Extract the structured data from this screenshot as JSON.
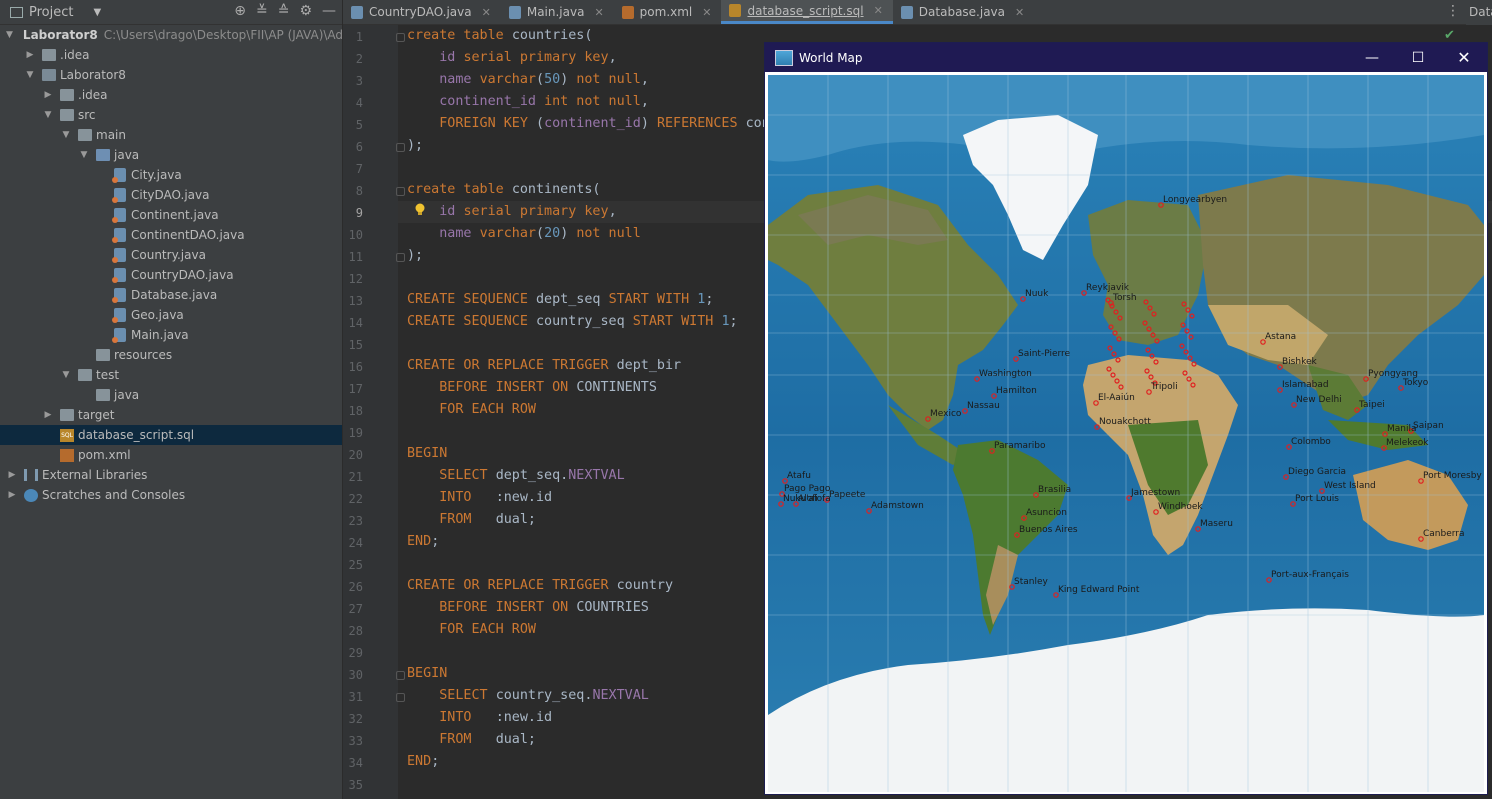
{
  "project_panel": {
    "title": "Project",
    "tree": [
      {
        "label": "Laborator8",
        "path": "C:\\Users\\drago\\Desktop\\FII\\AP (JAVA)\\AdvP",
        "icon": "module-folder-icon",
        "indent": 0,
        "arrow": "down",
        "bold": true
      },
      {
        "label": ".idea",
        "icon": "folder-icon",
        "indent": 1,
        "arrow": "right"
      },
      {
        "label": "Laborator8",
        "icon": "module-folder-icon",
        "indent": 1,
        "arrow": "down"
      },
      {
        "label": ".idea",
        "icon": "folder-icon",
        "indent": 2,
        "arrow": "right"
      },
      {
        "label": "src",
        "icon": "folder-icon",
        "indent": 2,
        "arrow": "down"
      },
      {
        "label": "main",
        "icon": "folder-icon",
        "indent": 3,
        "arrow": "down"
      },
      {
        "label": "java",
        "icon": "source-folder-icon",
        "indent": 4,
        "arrow": "down"
      },
      {
        "label": "City.java",
        "icon": "java-class-icon",
        "indent": 5
      },
      {
        "label": "CityDAO.java",
        "icon": "java-class-icon",
        "indent": 5
      },
      {
        "label": "Continent.java",
        "icon": "java-class-icon",
        "indent": 5
      },
      {
        "label": "ContinentDAO.java",
        "icon": "java-class-icon",
        "indent": 5
      },
      {
        "label": "Country.java",
        "icon": "java-class-icon",
        "indent": 5
      },
      {
        "label": "CountryDAO.java",
        "icon": "java-class-icon",
        "indent": 5
      },
      {
        "label": "Database.java",
        "icon": "java-class-icon",
        "indent": 5
      },
      {
        "label": "Geo.java",
        "icon": "java-class-icon",
        "indent": 5
      },
      {
        "label": "Main.java",
        "icon": "java-class-icon",
        "indent": 5
      },
      {
        "label": "resources",
        "icon": "folder-icon",
        "indent": 4
      },
      {
        "label": "test",
        "icon": "folder-icon",
        "indent": 3,
        "arrow": "down"
      },
      {
        "label": "java",
        "icon": "folder-icon",
        "indent": 4
      },
      {
        "label": "target",
        "icon": "folder-icon",
        "indent": 2,
        "arrow": "right"
      },
      {
        "label": "database_script.sql",
        "icon": "sql-file-icon",
        "indent": 2,
        "selected": true
      },
      {
        "label": "pom.xml",
        "icon": "xml-file-icon",
        "indent": 2
      },
      {
        "label": "External Libraries",
        "icon": "library-icon",
        "indent": 0,
        "arrow": "right"
      },
      {
        "label": "Scratches and Consoles",
        "icon": "scratches-icon",
        "indent": 0,
        "arrow": "right"
      }
    ]
  },
  "tabs": [
    {
      "label": "CountryDAO.java",
      "icon_color": "#6b8fb0"
    },
    {
      "label": "Main.java",
      "icon_color": "#6b8fb0"
    },
    {
      "label": "pom.xml",
      "icon_color": "#b56b2d"
    },
    {
      "label": "database_script.sql",
      "icon_color": "#b8862b",
      "active": true
    },
    {
      "label": "Database.java",
      "icon_color": "#6b8fb0"
    }
  ],
  "right_strip": {
    "label": "Data"
  },
  "code_lines": [
    "<span class='k'>create table </span>countries(",
    "    <span class='p'>id </span><span class='k'>serial primary key</span>,",
    "    <span class='p'>name </span><span class='k'>varchar</span>(<span class='n'>50</span>) <span class='k'>not null</span>,",
    "    <span class='p'>continent_id </span><span class='k'>int not null</span>,",
    "    <span class='k'>FOREIGN KEY </span>(<span class='p'>continent_id</span>) <span class='k'>REFERENCES </span>con",
    ");",
    "",
    "<span class='k'>create table </span>continents(",
    "    <span class='p'>id </span><span class='k'>serial primary key</span>,",
    "    <span class='p'>name </span><span class='k'>varchar</span>(<span class='n'>20</span>) <span class='k'>not null</span>",
    ");",
    "",
    "<span class='k'>CREATE SEQUENCE </span>dept_seq <span class='k'>START WITH </span><span class='n'>1</span>;",
    "<span class='k'>CREATE SEQUENCE </span>country_seq <span class='k'>START WITH </span><span class='n'>1</span>;",
    "",
    "<span class='k'>CREATE OR REPLACE TRIGGER </span>dept_bir",
    "    <span class='k'>BEFORE INSERT ON </span>CONTINENTS",
    "    <span class='k'>FOR EACH ROW</span>",
    "",
    "<span class='k'>BEGIN</span>",
    "    <span class='k'>SELECT </span>dept_seq.<span class='p'>NEXTVAL</span>",
    "    <span class='k'>INTO   </span>:new.id",
    "    <span class='k'>FROM   </span>dual;",
    "<span class='k'>END</span>;",
    "",
    "<span class='k'>CREATE OR REPLACE TRIGGER </span>country",
    "    <span class='k'>BEFORE INSERT ON </span>COUNTRIES",
    "    <span class='k'>FOR EACH ROW</span>",
    "",
    "<span class='k'>BEGIN</span>",
    "    <span class='k'>SELECT </span>country_seq.<span class='p'>NEXTVAL</span>",
    "    <span class='k'>INTO   </span>:new.id",
    "    <span class='k'>FROM   </span>dual;",
    "<span class='k'>END</span>;",
    ""
  ],
  "map_window": {
    "title": "World Map",
    "labels": [
      {
        "text": "Longyearbyen"
      },
      {
        "text": "Nuuk"
      },
      {
        "text": "Reykjavik"
      },
      {
        "text": "Torsh"
      },
      {
        "text": "Saint-Pierre"
      },
      {
        "text": "Washington"
      },
      {
        "text": "Hamilton"
      },
      {
        "text": "Nassau"
      },
      {
        "text": "Mexico"
      },
      {
        "text": "Paramaribo"
      },
      {
        "text": "El-Aaiún"
      },
      {
        "text": "Nouakchott"
      },
      {
        "text": "Tripoli"
      },
      {
        "text": "Astana"
      },
      {
        "text": "Bishkek"
      },
      {
        "text": "Islamabad"
      },
      {
        "text": "New Delhi"
      },
      {
        "text": "Pyongyang"
      },
      {
        "text": "Tokyo"
      },
      {
        "text": "Taipei"
      },
      {
        "text": "Saipan"
      },
      {
        "text": "Manila"
      },
      {
        "text": "Melekeok"
      },
      {
        "text": "Port Moresby"
      },
      {
        "text": "Colombo"
      },
      {
        "text": "Diego Garcia"
      },
      {
        "text": "West Island"
      },
      {
        "text": "Port Louis"
      },
      {
        "text": "Jamestown"
      },
      {
        "text": "Brasilia"
      },
      {
        "text": "Asuncion"
      },
      {
        "text": "Buenos Aires"
      },
      {
        "text": "Windhoek"
      },
      {
        "text": "Maseru"
      },
      {
        "text": "Canberra"
      },
      {
        "text": "Port-aux-Français"
      },
      {
        "text": "Stanley"
      },
      {
        "text": "King Edward Point"
      },
      {
        "text": "Adamstown"
      },
      {
        "text": "Papeete"
      },
      {
        "text": "Atafu"
      },
      {
        "text": "Pago Pago"
      },
      {
        "text": "Nuku'alofa"
      },
      {
        "text": "Alofi"
      }
    ]
  }
}
